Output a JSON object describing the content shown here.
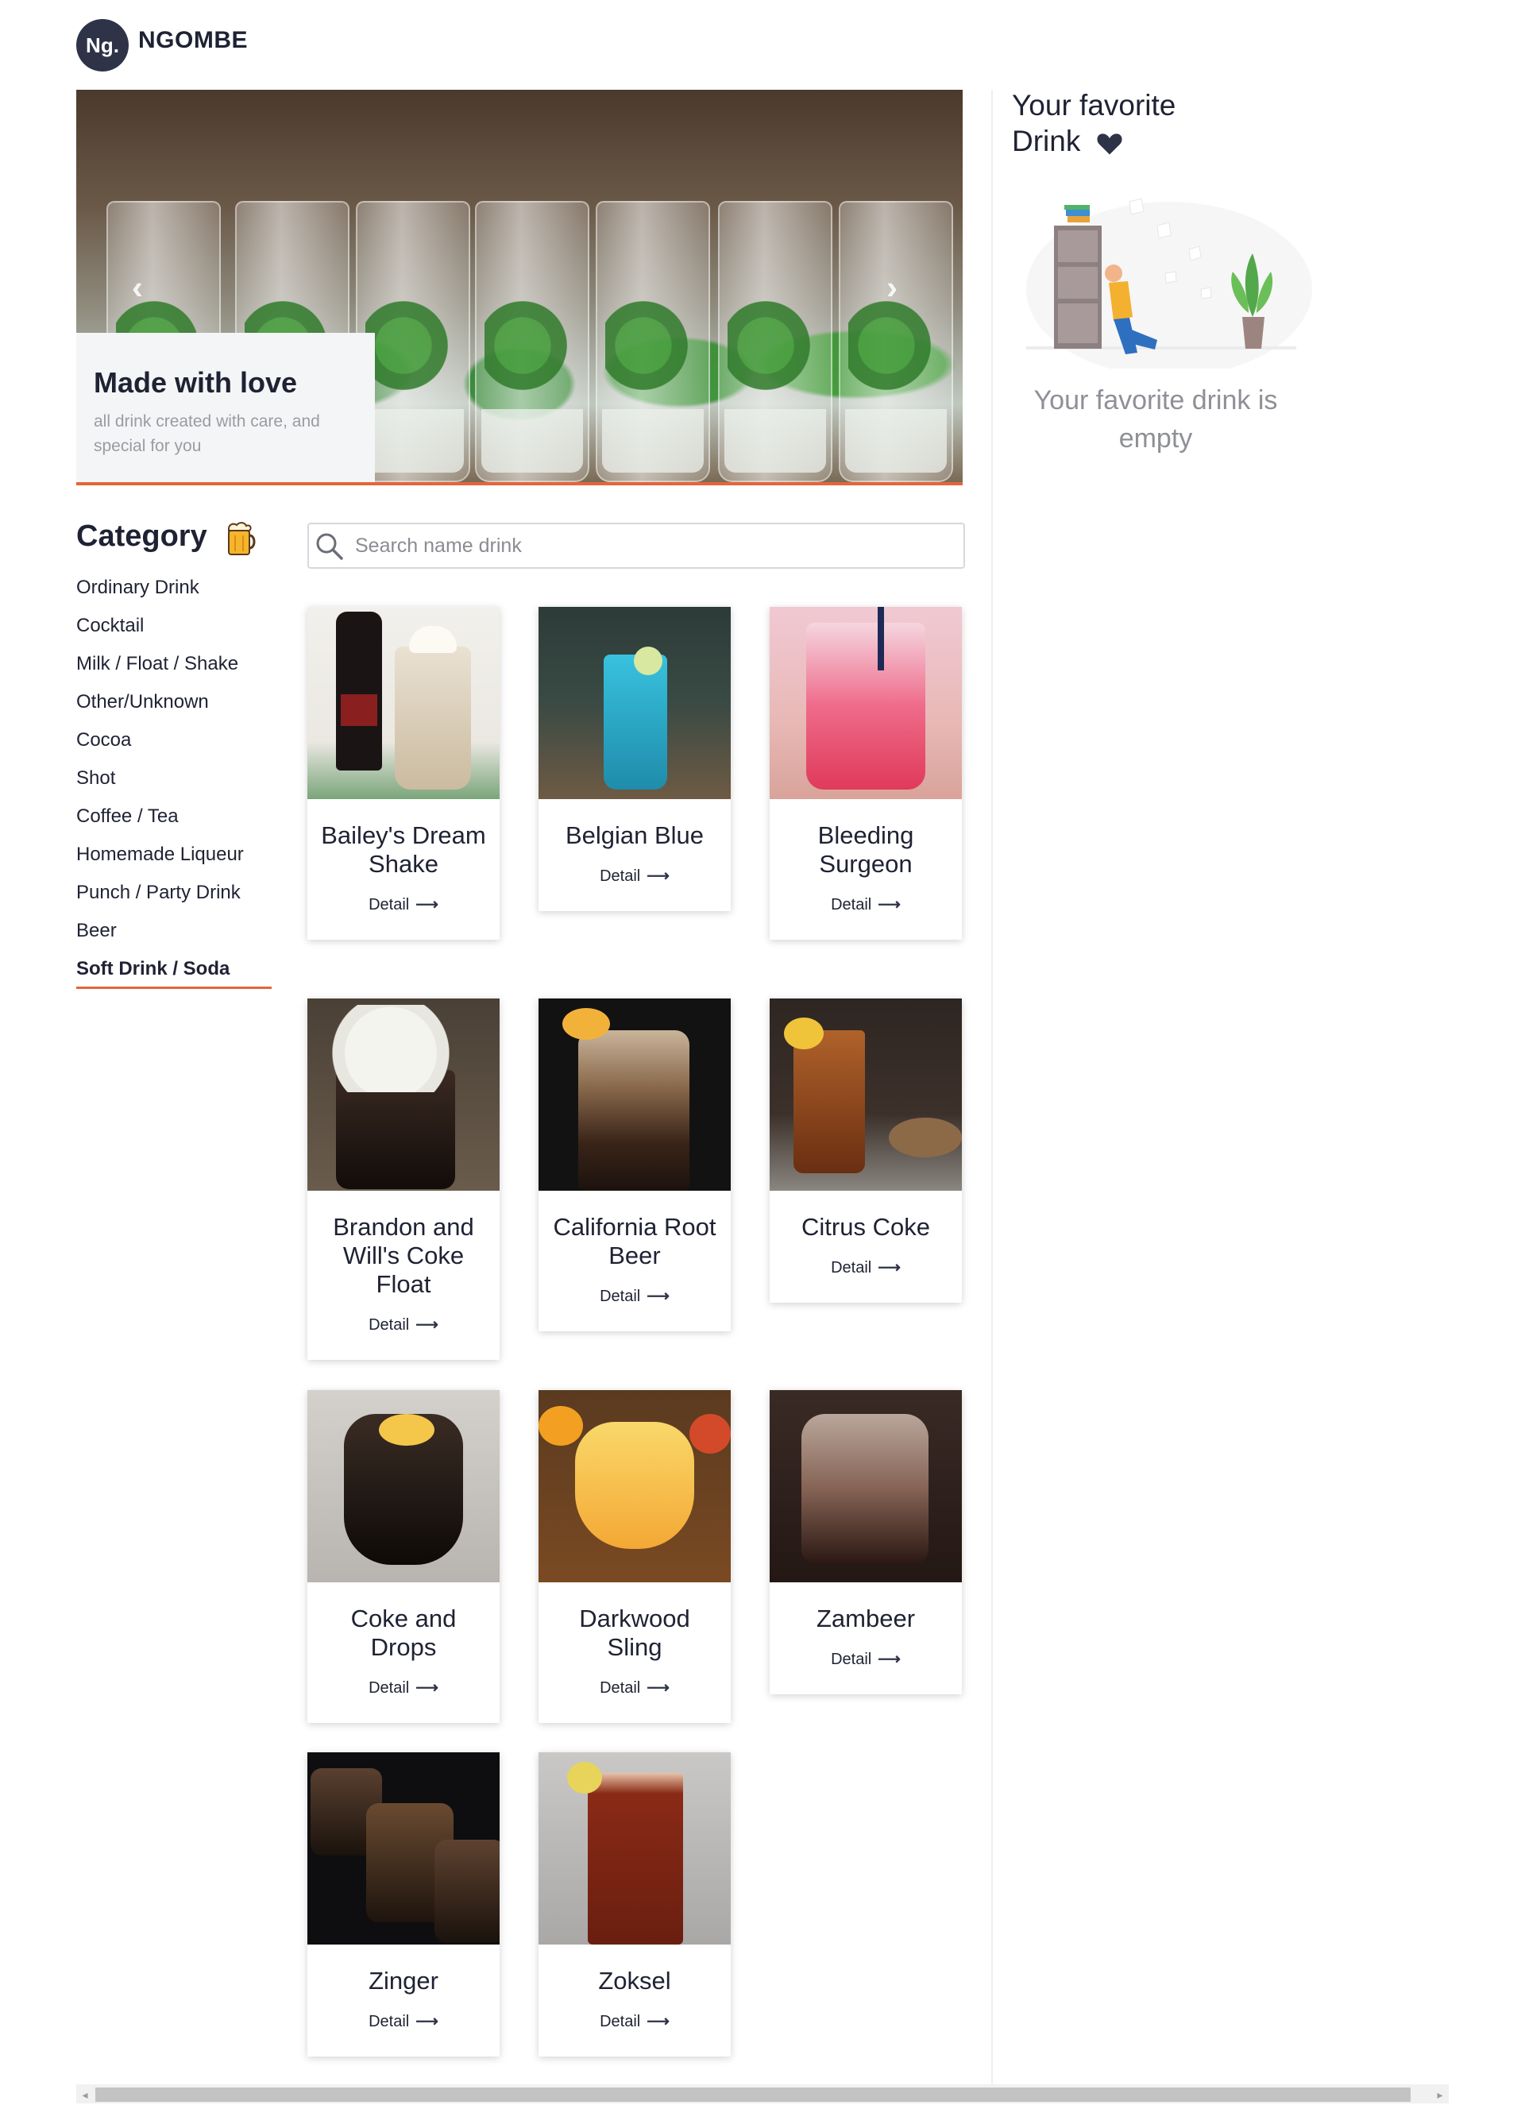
{
  "header": {
    "logo_text": "Ng.",
    "brand": "NGOMBE"
  },
  "hero": {
    "title": "Made with love",
    "subtitle": "all drink created with care, and special for you",
    "prev_icon": "chevron-left-icon",
    "next_icon": "chevron-right-icon",
    "accent_color": "#e4653b"
  },
  "favorite": {
    "title": "Your favorite Drink",
    "heart_icon": "heart-icon",
    "empty_text": "Your favorite drink is empty"
  },
  "category": {
    "title": "Category",
    "icon": "beer-mug-icon",
    "items": [
      "Ordinary Drink",
      "Cocktail",
      "Milk / Float / Shake",
      "Other/Unknown",
      "Cocoa",
      "Shot",
      "Coffee / Tea",
      "Homemade Liqueur",
      "Punch / Party Drink",
      "Beer",
      "Soft Drink / Soda"
    ],
    "active": "Soft Drink / Soda"
  },
  "search": {
    "placeholder": "Search name drink",
    "value": ""
  },
  "drinks": [
    {
      "name": "Bailey's Dream Shake",
      "detail": "Detail"
    },
    {
      "name": "Belgian Blue",
      "detail": "Detail"
    },
    {
      "name": "Bleeding Surgeon",
      "detail": "Detail"
    },
    {
      "name": "Brandon and Will's Coke Float",
      "detail": "Detail"
    },
    {
      "name": "California Root Beer",
      "detail": "Detail"
    },
    {
      "name": "Citrus Coke",
      "detail": "Detail"
    },
    {
      "name": "Coke and Drops",
      "detail": "Detail"
    },
    {
      "name": "Darkwood Sling",
      "detail": "Detail"
    },
    {
      "name": "Zambeer",
      "detail": "Detail"
    },
    {
      "name": "Zinger",
      "detail": "Detail"
    },
    {
      "name": "Zoksel",
      "detail": "Detail"
    }
  ]
}
